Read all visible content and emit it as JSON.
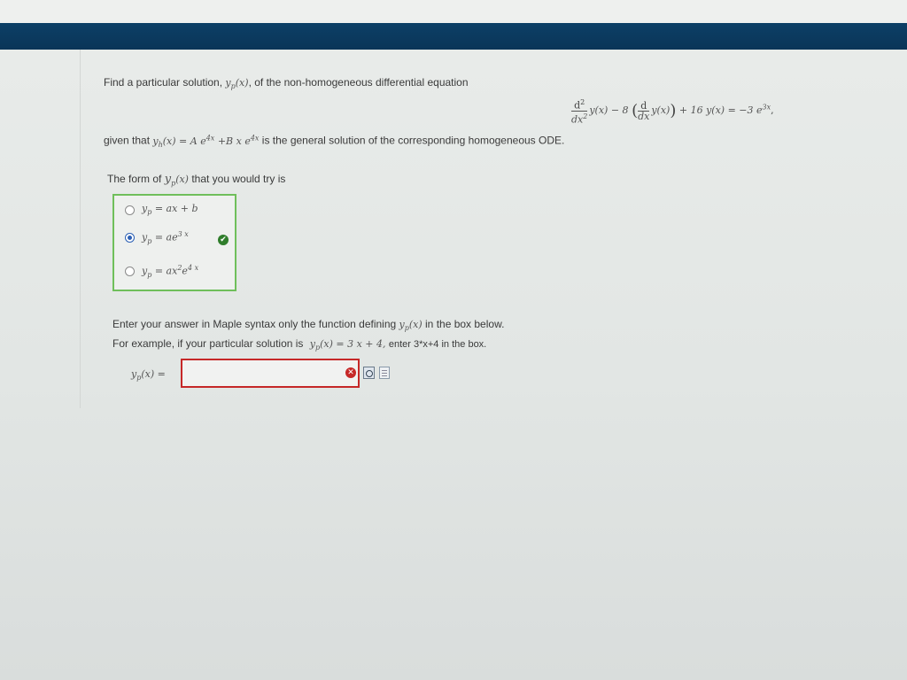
{
  "question": {
    "intro_text": "Find a particular solution,",
    "intro_fn": "y",
    "intro_sub": "p",
    "intro_arg": "(x)",
    "intro_rest": ", of the non-homogeneous differential equation",
    "ode": {
      "d2": "d",
      "d2_exp": "2",
      "dx2": "dx",
      "dx2_exp": "2",
      "term1": "y(x) − 8",
      "d1": "d",
      "dx1": "dx",
      "term2": "y(x)",
      "term3": "+ 16 y(x) = −3 e",
      "term3_exp": "3x",
      "tail": ","
    },
    "given_prefix": "given that",
    "yh_fn": "y",
    "yh_sub": "h",
    "yh_rest": "(x) = A e",
    "yh_exp1": "4x",
    "yh_mid": " +B x e",
    "yh_exp2": "4x",
    "given_suffix": "is the general solution of the corresponding homogeneous ODE."
  },
  "form_question": {
    "prefix": "The form of",
    "fn": "y",
    "sub": "p",
    "arg": "(x)",
    "suffix": "that you would try is"
  },
  "choices": [
    {
      "lhs": "y",
      "sub": "p",
      "rhs": " = ax + b",
      "exp": "",
      "rest": "",
      "selected": false
    },
    {
      "lhs": "y",
      "sub": "p",
      "rhs": " = ae",
      "exp": "3 x",
      "rest": "",
      "selected": true
    },
    {
      "lhs": "y",
      "sub": "p",
      "rhs": " = ax",
      "exp": "2",
      "rest": "e",
      "exp2": "4 x",
      "selected": false
    }
  ],
  "instructions": {
    "line1_prefix": "Enter your answer in Maple syntax only the function defining",
    "line1_fn": "y",
    "line1_sub": "p",
    "line1_arg": "(x)",
    "line1_suffix": "in the box below.",
    "line2_prefix": "For example, if your particular solution is",
    "line2_math": "y",
    "line2_sub": "p",
    "line2_math_rest": "(x) = 3 x + 4,",
    "line2_suffix": "enter 3*x+4 in the box."
  },
  "answer": {
    "label_fn": "y",
    "label_sub": "p",
    "label_rest": "(x) =",
    "value": ""
  },
  "colors": {
    "header": "#0a3558",
    "correct": "#2f7d2b",
    "error": "#c62828",
    "radio_selected": "#2b5fb4"
  },
  "icons": {
    "correct": "check-circle-icon",
    "error": "x-circle-icon",
    "preview": "preview-icon",
    "help": "help-document-icon"
  }
}
